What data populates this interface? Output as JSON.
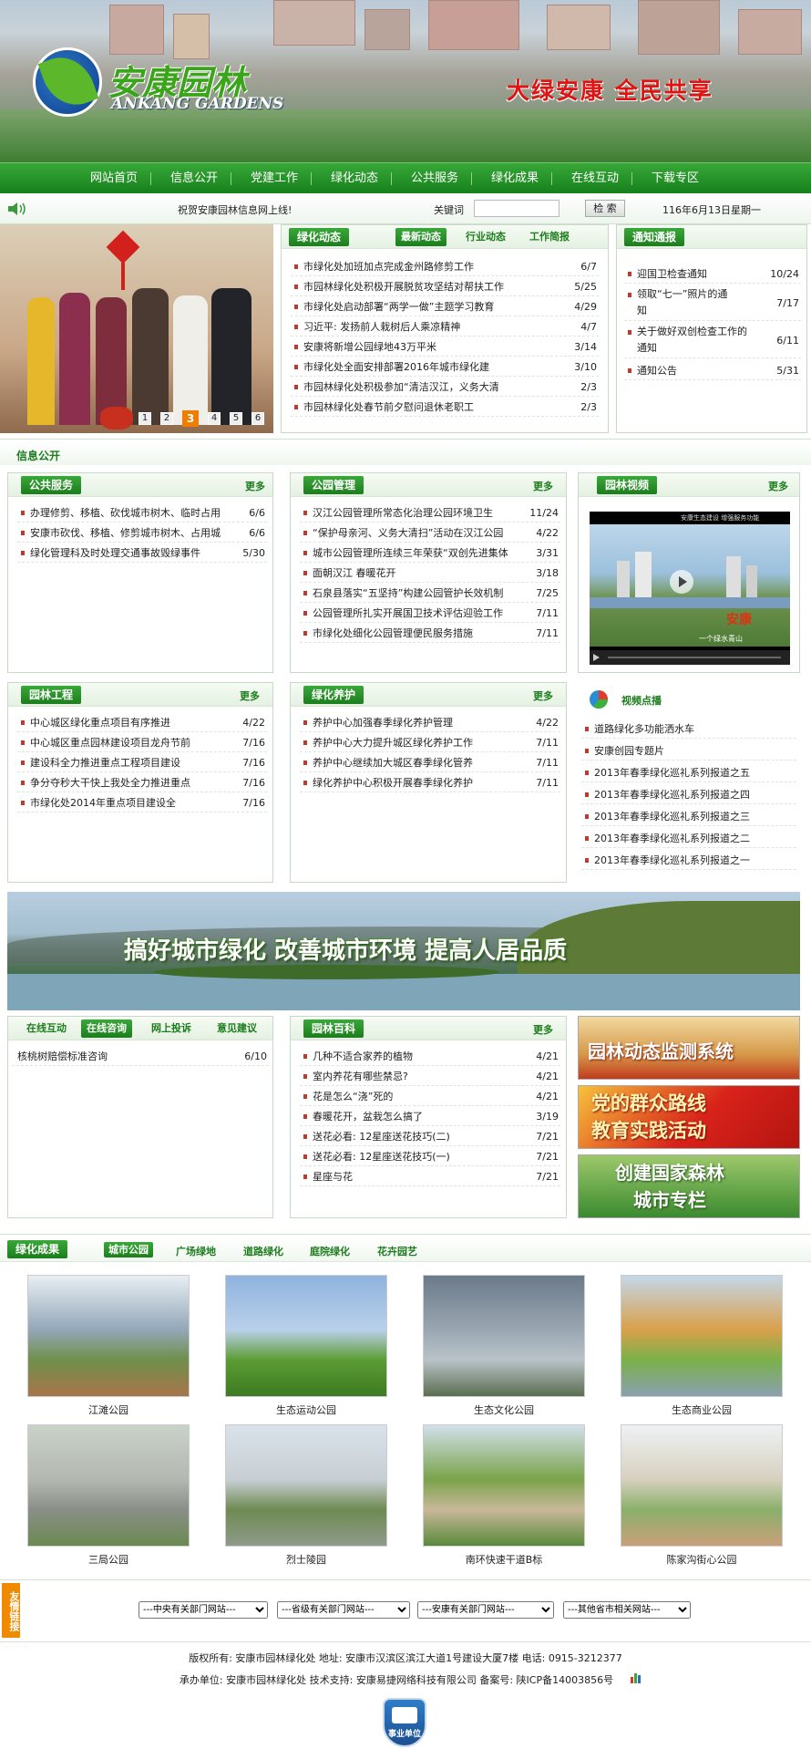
{
  "header": {
    "logo_cn": "安康园林",
    "logo_en": "ANKANG GARDENS",
    "slogan": "大绿安康  全民共享"
  },
  "nav": [
    "网站首页",
    "信息公开",
    "党建工作",
    "绿化动态",
    "公共服务",
    "绿化成果",
    "在线互动",
    "下载专区"
  ],
  "notice": {
    "text": "祝贺安康园林信息网上线!",
    "search_label": "关键词",
    "search_value": "",
    "search_button": "检 索",
    "date": "116年6月13日星期一"
  },
  "slideshow": {
    "pages": [
      "1",
      "2",
      "3",
      "4",
      "5",
      "6"
    ],
    "active": "3"
  },
  "greening_news": {
    "tab": "绿化动态",
    "subtabs": [
      "最新动态",
      "行业动态",
      "工作简报"
    ],
    "items": [
      [
        "市绿化处加班加点完成金州路修剪工作",
        "6/7"
      ],
      [
        "市园林绿化处积极开展脱贫攻坚结对帮扶工作",
        "5/25"
      ],
      [
        "市绿化处启动部署“两学一做”主题学习教育",
        "4/29"
      ],
      [
        "习近平: 发扬前人栽树后人乘凉精神",
        "4/7"
      ],
      [
        "安康将新增公园绿地43万平米",
        "3/14"
      ],
      [
        "市绿化处全面安排部署2016年城市绿化建",
        "3/10"
      ],
      [
        "市园林绿化处积极参加“清洁汉江，义务大清",
        "2/3"
      ],
      [
        "市园林绿化处春节前夕慰问退休老职工",
        "2/3"
      ]
    ]
  },
  "notices": {
    "tab": "通知通报",
    "items": [
      [
        "迎国卫检查通知",
        "10/24"
      ],
      [
        "领取“七一”照片的通知",
        "7/17"
      ],
      [
        "关于做好双创检查工作的通知",
        "6/11"
      ],
      [
        "通知公告",
        "5/31"
      ]
    ]
  },
  "info_title": "信息公开",
  "public_service": {
    "tab": "公共服务",
    "more": "更多",
    "items": [
      [
        "办理修剪、移植、砍伐城市树木、临时占用",
        "6/6"
      ],
      [
        "安康市砍伐、移植、修剪城市树木、占用城",
        "6/6"
      ],
      [
        "绿化管理科及时处理交通事故毁绿事件",
        "5/30"
      ]
    ]
  },
  "park_mgmt": {
    "tab": "公园管理",
    "more": "更多",
    "items": [
      [
        "汉江公园管理所常态化治理公园环境卫生",
        "11/24"
      ],
      [
        "“保护母亲河、义务大清扫”活动在汉江公园",
        "4/22"
      ],
      [
        "城市公园管理所连续三年荣获“双创先进集体",
        "3/31"
      ],
      [
        "面朝汉江  春暖花开",
        "3/18"
      ],
      [
        "石泉县落实“五坚持”构建公园管护长效机制",
        "7/25"
      ],
      [
        "公园管理所扎实开展国卫技术评估迎验工作",
        "7/11"
      ],
      [
        "市绿化处细化公园管理便民服务措施",
        "7/11"
      ]
    ]
  },
  "garden_video": {
    "tab": "园林视频",
    "more": "更多",
    "caption": "安康生态建设  增强服务功能",
    "sub": "安康",
    "sub2": "一个绿水青山"
  },
  "garden_eng": {
    "tab": "园林工程",
    "more": "更多",
    "items": [
      [
        "中心城区绿化重点项目有序推进",
        "4/22"
      ],
      [
        "中心城区重点园林建设项目龙舟节前",
        "7/16"
      ],
      [
        "建设科全力推进重点工程项目建设",
        "7/16"
      ],
      [
        "争分夺秒大干快上我处全力推进重点",
        "7/16"
      ],
      [
        "市绿化处2014年重点项目建设全",
        "7/16"
      ]
    ]
  },
  "greening_care": {
    "tab": "绿化养护",
    "more": "更多",
    "items": [
      [
        "养护中心加强春季绿化养护管理",
        "4/22"
      ],
      [
        "养护中心大力提升城区绿化养护工作",
        "7/11"
      ],
      [
        "养护中心继续加大城区春季绿化管养",
        "7/11"
      ],
      [
        "绿化养护中心积极开展春季绿化养护",
        "7/11"
      ]
    ]
  },
  "video_vod": {
    "title": "视频点播",
    "items": [
      "道路绿化多功能洒水车",
      "安康创园专题片",
      "2013年春季绿化巡礼系列报道之五",
      "2013年春季绿化巡礼系列报道之四",
      "2013年春季绿化巡礼系列报道之三",
      "2013年春季绿化巡礼系列报道之二",
      "2013年春季绿化巡礼系列报道之一"
    ]
  },
  "banner": {
    "text": "搞好城市绿化  改善城市环境  提高人居品质"
  },
  "online": {
    "tabs": [
      "在线互动",
      "在线咨询",
      "网上投诉",
      "意见建议"
    ],
    "items": [
      [
        "核桃树赔偿标准咨询",
        "6/10"
      ]
    ]
  },
  "encyclopedia": {
    "tab": "园林百科",
    "more": "更多",
    "items": [
      [
        "几种不适合家养的植物",
        "4/21"
      ],
      [
        "室内养花有哪些禁忌?",
        "4/21"
      ],
      [
        "花是怎么“浇”死的",
        "4/21"
      ],
      [
        "春暖花开，盆栽怎么搞了",
        "3/19"
      ],
      [
        "送花必看: 12星座送花技巧(二)",
        "7/21"
      ],
      [
        "送花必看: 12星座送花技巧(一)",
        "7/21"
      ],
      [
        "星座与花",
        "7/21"
      ]
    ]
  },
  "ads": [
    "园林动态监测系统",
    "党的群众路线\n教育实践活动",
    "创建国家森林\n城市专栏"
  ],
  "achievements": {
    "tab": "绿化成果",
    "subtabs": [
      "城市公园",
      "广场绿地",
      "道路绿化",
      "庭院绿化",
      "花卉园艺"
    ],
    "photos": [
      "江滩公园",
      "生态运动公园",
      "生态文化公园",
      "生态商业公园",
      "三局公园",
      "烈士陵园",
      "南环快速干道B标",
      "陈家沟街心公园"
    ]
  },
  "links": {
    "label": "友情链接",
    "selects": [
      "---中央有关部门网站---",
      "---省级有关部门网站---",
      "---安康有关部门网站---",
      "---其他省市相关网站---"
    ]
  },
  "footer": {
    "line1": "版权所有: 安康市园林绿化处  地址: 安康市汉滨区滨江大道1号建设大厦7楼  电话: 0915-3212377",
    "line2": "承办单位: 安康市园林绿化处  技术支持: 安康易捷网络科技有限公司  备案号: 陕ICP备14003856号",
    "badge": "事业单位"
  },
  "colors": {
    "green": "#1c7d1c",
    "accent_red": "#c0392b"
  }
}
